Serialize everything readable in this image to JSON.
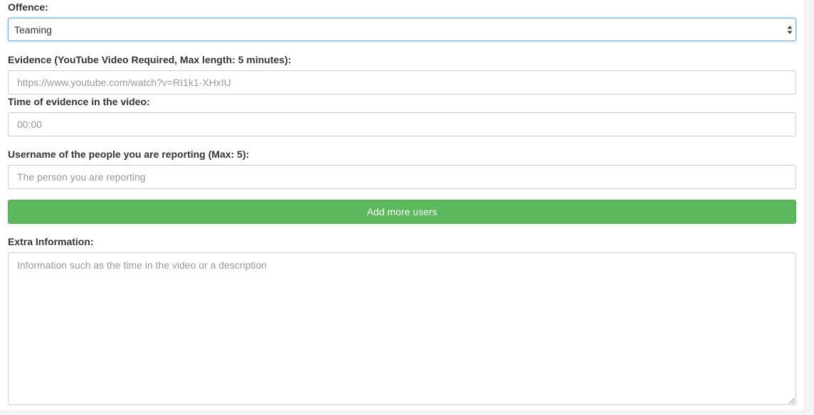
{
  "offence": {
    "label": "Offence:",
    "selected": "Teaming"
  },
  "evidence": {
    "label": "Evidence (YouTube Video Required, Max length: 5 minutes):",
    "placeholder": "https://www.youtube.com/watch?v=RI1k1-XHxIU"
  },
  "time": {
    "label": "Time of evidence in the video:",
    "placeholder": "00:00"
  },
  "reported_users": {
    "label": "Username of the people you are reporting (Max: 5):",
    "placeholder": "The person you are reporting",
    "add_button_label": "Add more users"
  },
  "extra_info": {
    "label": "Extra Information:",
    "placeholder": "Information such as the time in the video or a description"
  },
  "colors": {
    "button_green": "#5cb85c",
    "focus_blue": "#66afe9",
    "border_gray": "#cccccc"
  }
}
